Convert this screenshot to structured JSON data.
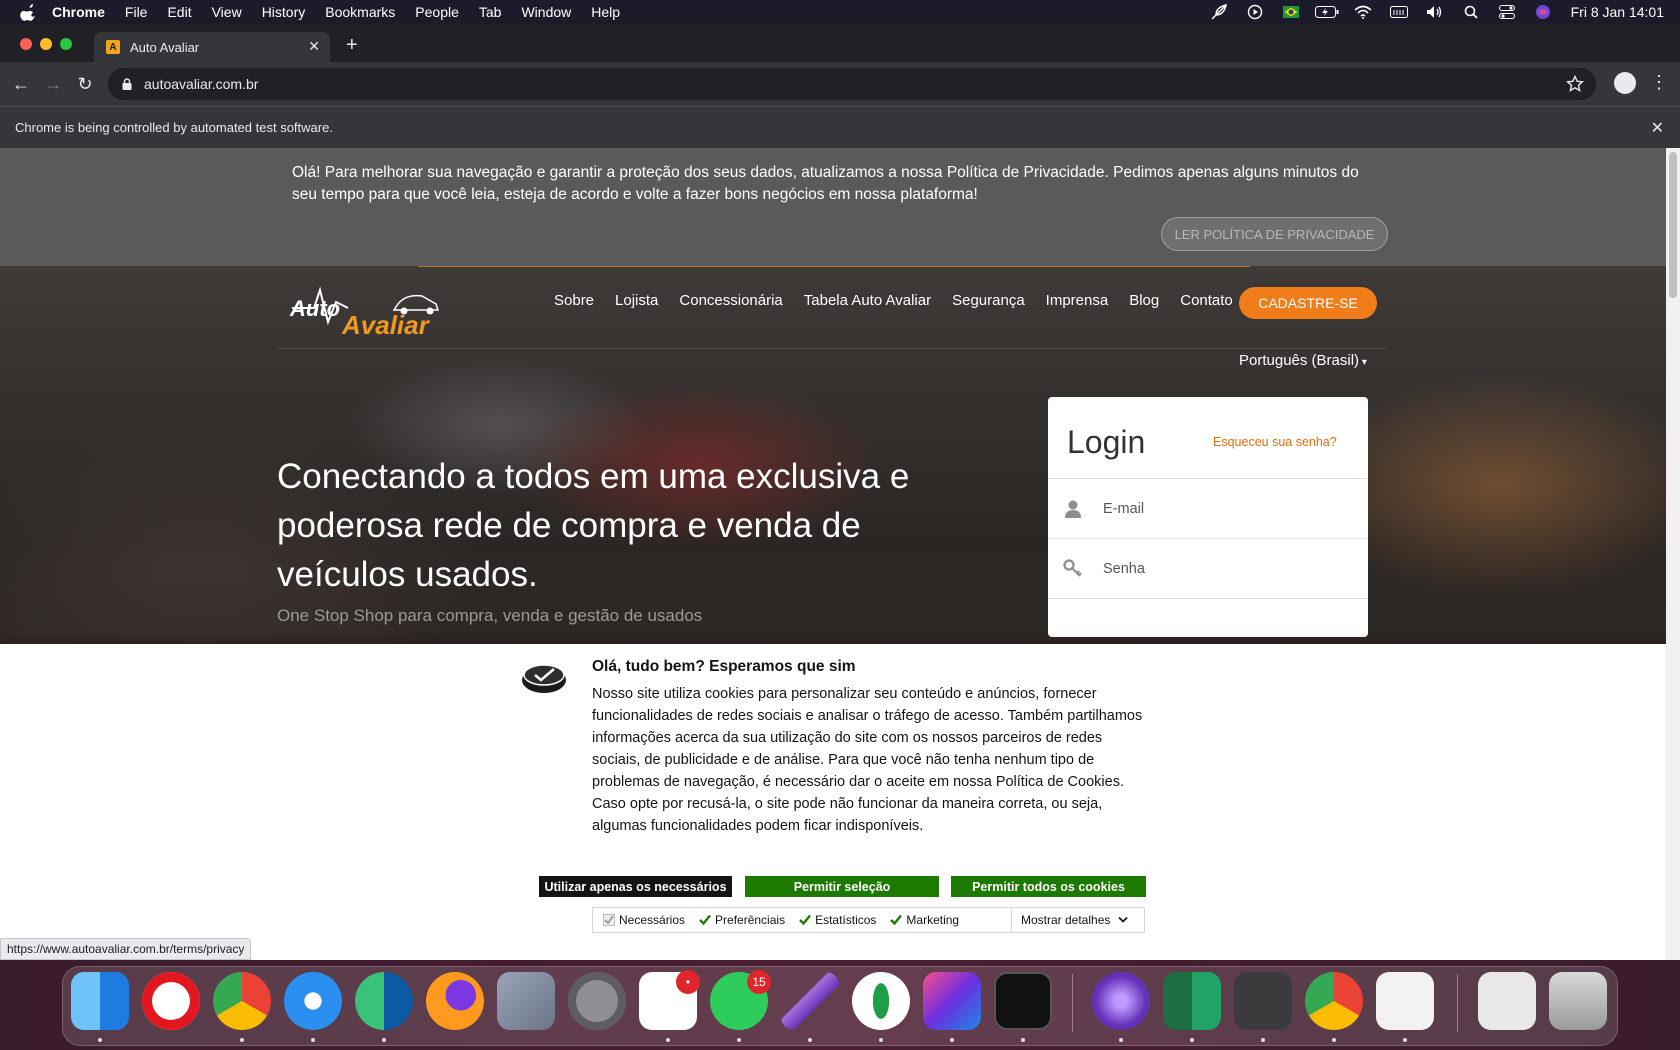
{
  "menubar": {
    "app": "Chrome",
    "items": [
      "File",
      "Edit",
      "View",
      "History",
      "Bookmarks",
      "People",
      "Tab",
      "Window",
      "Help"
    ],
    "clock": "Fri 8 Jan  14:01"
  },
  "browser": {
    "tab_title": "Auto Avaliar",
    "url": "autoavaliar.com.br",
    "infobar": "Chrome is being controlled by automated test software.",
    "status_url": "https://www.autoavaliar.com.br/terms/privacy"
  },
  "privacy_banner": {
    "text": "Olá! Para melhorar sua navegação e garantir a proteção dos seus dados, atualizamos a nossa Política de Privacidade. Pedimos apenas alguns minutos do seu tempo para que você leia, esteja de acordo e volte a fazer bons negócios em nossa plataforma!",
    "button": "LER POLÍTICA DE PRIVACIDADE"
  },
  "site": {
    "logo_line1": "Auto",
    "logo_line2": "Avaliar",
    "nav": [
      "Sobre",
      "Lojista",
      "Concessionária",
      "Tabela Auto Avaliar",
      "Segurança",
      "Imprensa",
      "Blog",
      "Contato"
    ],
    "signup": "CADASTRE-SE",
    "language": "Português (Brasil)",
    "headline": "Conectando a todos em uma exclusiva e poderosa rede de compra e venda de veículos usados.",
    "subline": "One Stop Shop para compra, venda e gestão de usados"
  },
  "login": {
    "title": "Login",
    "forgot": "Esqueceu sua senha?",
    "email_placeholder": "E-mail",
    "password_placeholder": "Senha"
  },
  "cookie": {
    "title": "Olá, tudo bem? Esperamos que sim",
    "body": "Nosso site utiliza cookies para personalizar seu conteúdo e anúncios, fornecer funcionalidades de redes sociais e analisar o tráfego de acesso. Também partilhamos informações acerca da sua utilização do site com os nossos parceiros de redes sociais, de publicidade e de análise. Para que você não tenha nenhum tipo de problemas de navegação, é necessário dar o aceite em nossa Política de Cookies. Caso opte por recusá-la, o site pode não funcionar da maneira correta, ou seja, algumas funcionalidades podem ficar indisponíveis.",
    "btn_necessary": "Utilizar apenas os necessários",
    "btn_selection": "Permitir seleção",
    "btn_all": "Permitir todos os cookies",
    "checks": [
      "Necessários",
      "Preferênciais",
      "Estatísticos",
      "Marketing"
    ],
    "show_details": "Mostrar detalhes"
  },
  "dock": {
    "slack_badge": "•",
    "whatsapp_badge": "15"
  },
  "colors": {
    "accent_orange": "#f07d19",
    "cookie_green": "#1c7a00"
  }
}
